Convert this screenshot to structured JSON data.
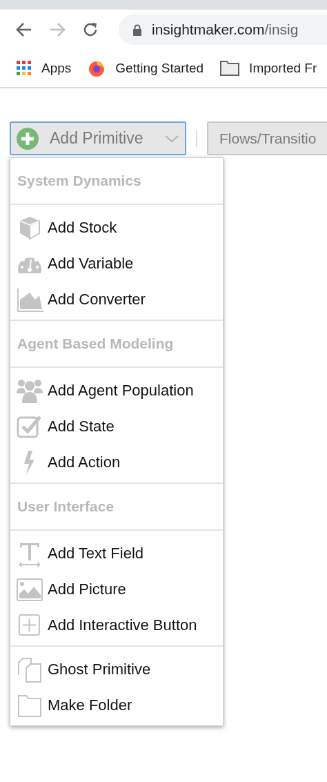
{
  "browser": {
    "address": {
      "host": "insightmaker.com",
      "path": "/insig"
    },
    "bookmarks": [
      {
        "kind": "apps",
        "label": "Apps"
      },
      {
        "kind": "firefox",
        "label": "Getting Started"
      },
      {
        "kind": "folder",
        "label": "Imported Fr"
      }
    ]
  },
  "toolbar": {
    "add_button": {
      "label": "Add Primitive",
      "focused": true
    },
    "flows_button": {
      "label": "Flows/Transitio"
    }
  },
  "menu": [
    {
      "heading": "System Dynamics",
      "items": [
        {
          "kind": "cube",
          "label": "Add Stock"
        },
        {
          "kind": "gauge",
          "label": "Add Variable"
        },
        {
          "kind": "area",
          "label": "Add Converter"
        }
      ]
    },
    {
      "heading": "Agent Based Modeling",
      "items": [
        {
          "kind": "people",
          "label": "Add Agent Population"
        },
        {
          "kind": "check",
          "label": "Add State"
        },
        {
          "kind": "bolt",
          "label": "Add Action"
        }
      ]
    },
    {
      "heading": "User Interface",
      "items": [
        {
          "kind": "text",
          "label": "Add Text Field"
        },
        {
          "kind": "image",
          "label": "Add Picture"
        },
        {
          "kind": "plus",
          "label": "Add Interactive Button"
        }
      ]
    },
    {
      "items": [
        {
          "kind": "copy",
          "label": "Ghost Primitive"
        },
        {
          "kind": "folder",
          "label": "Make Folder"
        }
      ]
    }
  ]
}
